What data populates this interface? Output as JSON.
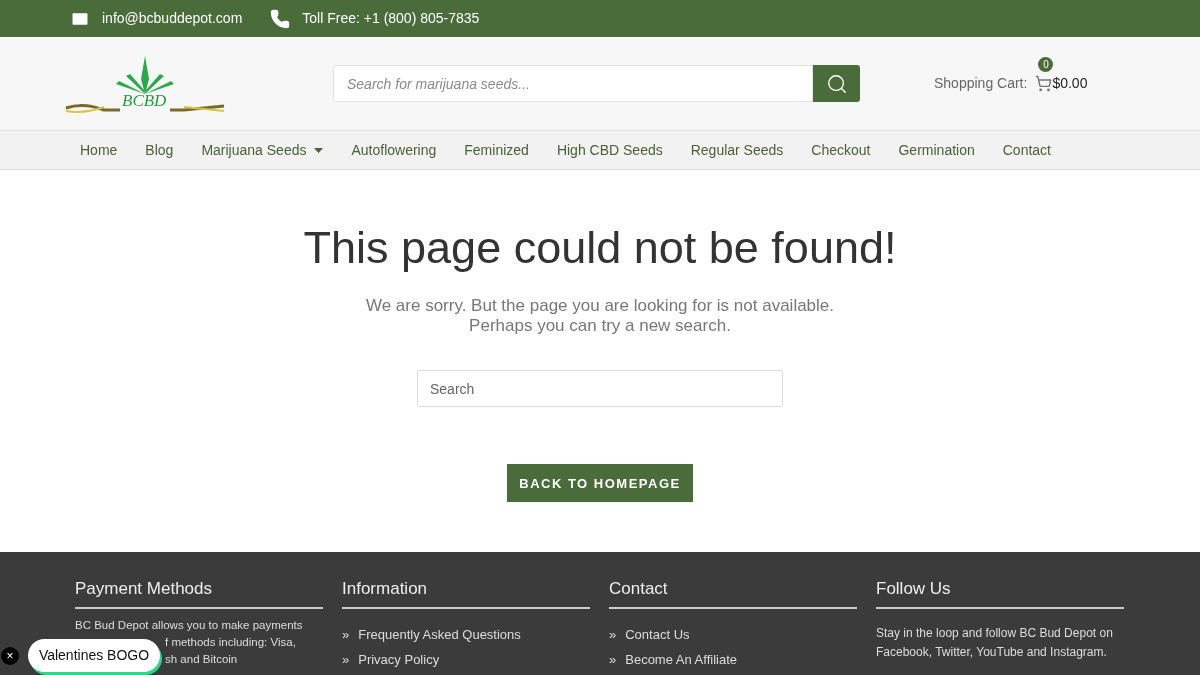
{
  "top_bar": {
    "email": "info@bcbuddepot.com",
    "phone": "Toll Free: +1 (800) 805-7835"
  },
  "header": {
    "logo_text": "BCBD",
    "search": {
      "placeholder": "Search for marijuana seeds..."
    },
    "cart": {
      "label": "Shopping Cart:",
      "count": "0",
      "total": "$0.00"
    }
  },
  "nav": [
    {
      "label": "Home",
      "has_dropdown": false
    },
    {
      "label": "Blog",
      "has_dropdown": false
    },
    {
      "label": "Marijuana Seeds",
      "has_dropdown": true
    },
    {
      "label": "Autoflowering",
      "has_dropdown": false
    },
    {
      "label": "Feminized",
      "has_dropdown": false
    },
    {
      "label": "High CBD Seeds",
      "has_dropdown": false
    },
    {
      "label": "Regular Seeds",
      "has_dropdown": false
    },
    {
      "label": "Checkout",
      "has_dropdown": false
    },
    {
      "label": "Germination",
      "has_dropdown": false
    },
    {
      "label": "Contact",
      "has_dropdown": false
    }
  ],
  "main": {
    "title": "This page could not be found!",
    "message_lines": [
      "We are sorry. But the page you are looking for is not available.",
      "Perhaps you can try a new search."
    ],
    "search": {
      "placeholder": "Search"
    },
    "button": "BACK TO HOMEPAGE"
  },
  "footer": {
    "columns": [
      {
        "kind": "text",
        "title": "Payment Methods",
        "lines": [
          "BC Bud Depot allows you to make payments",
          "f methods including: Visa,",
          "sh and Bitcoin"
        ]
      },
      {
        "kind": "links",
        "title": "Information",
        "bullet": "»",
        "links": [
          "Frequently Asked Questions",
          "Privacy Policy"
        ]
      },
      {
        "kind": "links",
        "title": "Contact",
        "bullet": "»",
        "links": [
          "Contact Us",
          "Become An Affiliate"
        ]
      },
      {
        "kind": "paragraph",
        "title": "Follow Us",
        "text": "Stay in the loop and follow BC Bud Depot on Facebook, Twitter, YouTube and Instagram."
      }
    ]
  },
  "promo": {
    "close": "×",
    "label": "Valentines BOGO"
  }
}
